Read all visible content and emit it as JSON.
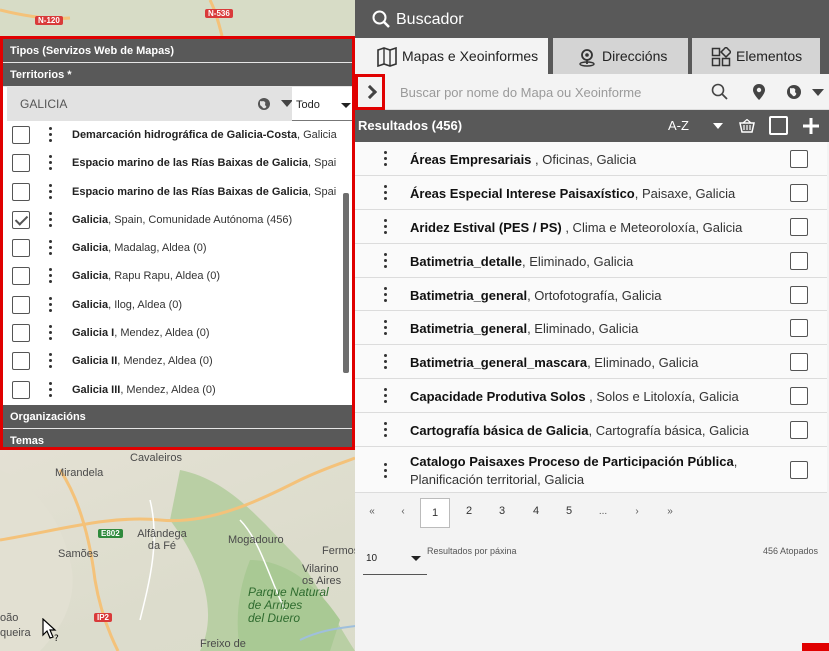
{
  "map": {
    "labels": {
      "cavaleiros": "Cavaleiros",
      "mirandela": "Mirandela",
      "alfandega": "Alfândega\nda Fé",
      "samoes": "Samões",
      "mogadouro": "Mogadouro",
      "fermo": "Fermos",
      "vilarino": "Vilarino\nos Aires",
      "freixo": "Freixo de",
      "queira": "queira",
      "oao": "oão",
      "park": "Parque Natural\nde Arribes\ndel Duero"
    },
    "roads": {
      "n120": "N-120",
      "n536": "N-536",
      "e802": "E802",
      "ip2": "IP2"
    }
  },
  "filters": {
    "types_header": "Tipos (Servizos Web de Mapas)",
    "territories_header": "Territorios *",
    "territory_search_value": "GALICIA",
    "territory_scope_select": "Todo",
    "territories": [
      {
        "bold": "Demarcación hidrográfica de Galicia-Costa",
        "rest": ", Galicia",
        "checked": false
      },
      {
        "bold": "Espacio marino de las Rías Baixas de Galicia",
        "rest": ", Spai",
        "checked": false
      },
      {
        "bold": "Espacio marino de las Rías Baixas de Galicia",
        "rest": ", Spai",
        "checked": false
      },
      {
        "bold": "Galicia",
        "rest": ", Spain, Comunidade Autónoma (456)",
        "checked": true
      },
      {
        "bold": "Galicia",
        "rest": ", Madalag, Aldea (0)",
        "checked": false
      },
      {
        "bold": "Galicia",
        "rest": ", Rapu Rapu, Aldea (0)",
        "checked": false
      },
      {
        "bold": "Galicia",
        "rest": ", Ilog, Aldea (0)",
        "checked": false
      },
      {
        "bold": "Galicia I",
        "rest": ", Mendez, Aldea (0)",
        "checked": false
      },
      {
        "bold": "Galicia II",
        "rest": ", Mendez, Aldea (0)",
        "checked": false
      },
      {
        "bold": "Galicia III",
        "rest": ", Mendez, Aldea (0)",
        "checked": false
      }
    ],
    "organizations_header": "Organizacións",
    "themes_header": "Temas"
  },
  "panel": {
    "title": "Buscador",
    "tabs": [
      "Mapas e Xeoinformes",
      "Direccións",
      "Elementos"
    ],
    "search_placeholder": "Buscar por nome do Mapa ou Xeoinforme",
    "results_label": "Resultados (456)",
    "sort_label": "A-Z",
    "results": [
      {
        "bold": "Áreas Empresariais",
        "rest": " , Oficinas, Galicia"
      },
      {
        "bold": "Áreas Especial Interese Paisaxístico",
        "rest": ", Paisaxe, Galicia"
      },
      {
        "bold": "Aridez Estival (PES / PS)",
        "rest": " , Clima e Meteoroloxía, Galicia"
      },
      {
        "bold": "Batimetria_detalle",
        "rest": ", Eliminado, Galicia"
      },
      {
        "bold": "Batimetria_general",
        "rest": ", Ortofotografía, Galicia"
      },
      {
        "bold": "Batimetria_general",
        "rest": ", Eliminado, Galicia"
      },
      {
        "bold": "Batimetria_general_mascara",
        "rest": ", Eliminado, Galicia"
      },
      {
        "bold": "Capacidade Produtiva Solos",
        "rest": " , Solos e Litoloxía, Galicia"
      },
      {
        "bold": "Cartografía básica de Galicia",
        "rest": ", Cartografía básica, Galicia"
      },
      {
        "bold": "Catalogo Paisaxes Proceso de Participación Pública",
        "rest": ", Planificación territorial, Galicia"
      }
    ],
    "pagination": {
      "first": "«",
      "prev": "‹",
      "pages": [
        "1",
        "2",
        "3",
        "4",
        "5"
      ],
      "ellipsis": "...",
      "next": "›",
      "last": "»",
      "current": "1"
    },
    "per_page_value": "10",
    "per_page_label": "Resultados por páxina",
    "found_label": "456 Atopados"
  },
  "colors": {
    "header_gray": "#595959",
    "highlight_red": "#e00000",
    "panel_bg": "#f3f3f3"
  }
}
